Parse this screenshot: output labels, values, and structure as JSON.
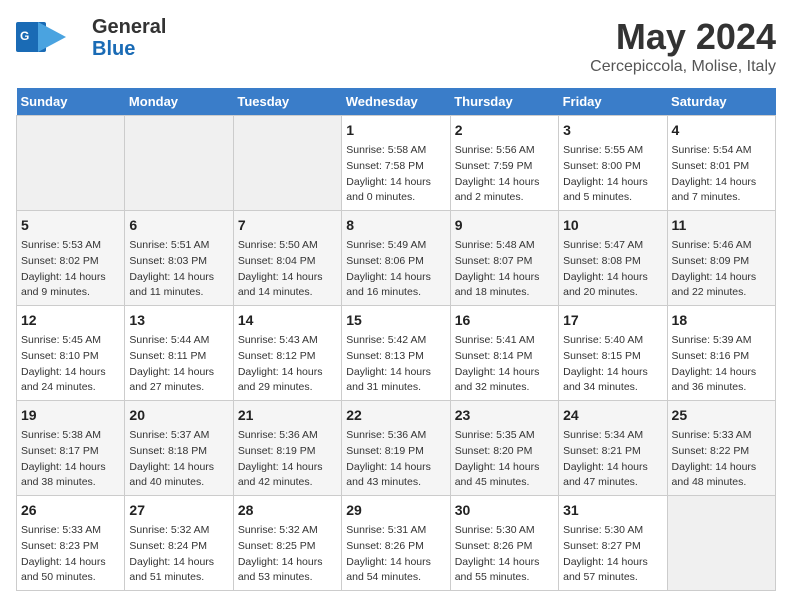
{
  "header": {
    "logo_line1": "General",
    "logo_line2": "Blue",
    "title": "May 2024",
    "subtitle": "Cercepiccola, Molise, Italy"
  },
  "days_of_week": [
    "Sunday",
    "Monday",
    "Tuesday",
    "Wednesday",
    "Thursday",
    "Friday",
    "Saturday"
  ],
  "weeks": [
    [
      {
        "day": "",
        "info": ""
      },
      {
        "day": "",
        "info": ""
      },
      {
        "day": "",
        "info": ""
      },
      {
        "day": "1",
        "info": "Sunrise: 5:58 AM\nSunset: 7:58 PM\nDaylight: 14 hours\nand 0 minutes."
      },
      {
        "day": "2",
        "info": "Sunrise: 5:56 AM\nSunset: 7:59 PM\nDaylight: 14 hours\nand 2 minutes."
      },
      {
        "day": "3",
        "info": "Sunrise: 5:55 AM\nSunset: 8:00 PM\nDaylight: 14 hours\nand 5 minutes."
      },
      {
        "day": "4",
        "info": "Sunrise: 5:54 AM\nSunset: 8:01 PM\nDaylight: 14 hours\nand 7 minutes."
      }
    ],
    [
      {
        "day": "5",
        "info": "Sunrise: 5:53 AM\nSunset: 8:02 PM\nDaylight: 14 hours\nand 9 minutes."
      },
      {
        "day": "6",
        "info": "Sunrise: 5:51 AM\nSunset: 8:03 PM\nDaylight: 14 hours\nand 11 minutes."
      },
      {
        "day": "7",
        "info": "Sunrise: 5:50 AM\nSunset: 8:04 PM\nDaylight: 14 hours\nand 14 minutes."
      },
      {
        "day": "8",
        "info": "Sunrise: 5:49 AM\nSunset: 8:06 PM\nDaylight: 14 hours\nand 16 minutes."
      },
      {
        "day": "9",
        "info": "Sunrise: 5:48 AM\nSunset: 8:07 PM\nDaylight: 14 hours\nand 18 minutes."
      },
      {
        "day": "10",
        "info": "Sunrise: 5:47 AM\nSunset: 8:08 PM\nDaylight: 14 hours\nand 20 minutes."
      },
      {
        "day": "11",
        "info": "Sunrise: 5:46 AM\nSunset: 8:09 PM\nDaylight: 14 hours\nand 22 minutes."
      }
    ],
    [
      {
        "day": "12",
        "info": "Sunrise: 5:45 AM\nSunset: 8:10 PM\nDaylight: 14 hours\nand 24 minutes."
      },
      {
        "day": "13",
        "info": "Sunrise: 5:44 AM\nSunset: 8:11 PM\nDaylight: 14 hours\nand 27 minutes."
      },
      {
        "day": "14",
        "info": "Sunrise: 5:43 AM\nSunset: 8:12 PM\nDaylight: 14 hours\nand 29 minutes."
      },
      {
        "day": "15",
        "info": "Sunrise: 5:42 AM\nSunset: 8:13 PM\nDaylight: 14 hours\nand 31 minutes."
      },
      {
        "day": "16",
        "info": "Sunrise: 5:41 AM\nSunset: 8:14 PM\nDaylight: 14 hours\nand 32 minutes."
      },
      {
        "day": "17",
        "info": "Sunrise: 5:40 AM\nSunset: 8:15 PM\nDaylight: 14 hours\nand 34 minutes."
      },
      {
        "day": "18",
        "info": "Sunrise: 5:39 AM\nSunset: 8:16 PM\nDaylight: 14 hours\nand 36 minutes."
      }
    ],
    [
      {
        "day": "19",
        "info": "Sunrise: 5:38 AM\nSunset: 8:17 PM\nDaylight: 14 hours\nand 38 minutes."
      },
      {
        "day": "20",
        "info": "Sunrise: 5:37 AM\nSunset: 8:18 PM\nDaylight: 14 hours\nand 40 minutes."
      },
      {
        "day": "21",
        "info": "Sunrise: 5:36 AM\nSunset: 8:19 PM\nDaylight: 14 hours\nand 42 minutes."
      },
      {
        "day": "22",
        "info": "Sunrise: 5:36 AM\nSunset: 8:19 PM\nDaylight: 14 hours\nand 43 minutes."
      },
      {
        "day": "23",
        "info": "Sunrise: 5:35 AM\nSunset: 8:20 PM\nDaylight: 14 hours\nand 45 minutes."
      },
      {
        "day": "24",
        "info": "Sunrise: 5:34 AM\nSunset: 8:21 PM\nDaylight: 14 hours\nand 47 minutes."
      },
      {
        "day": "25",
        "info": "Sunrise: 5:33 AM\nSunset: 8:22 PM\nDaylight: 14 hours\nand 48 minutes."
      }
    ],
    [
      {
        "day": "26",
        "info": "Sunrise: 5:33 AM\nSunset: 8:23 PM\nDaylight: 14 hours\nand 50 minutes."
      },
      {
        "day": "27",
        "info": "Sunrise: 5:32 AM\nSunset: 8:24 PM\nDaylight: 14 hours\nand 51 minutes."
      },
      {
        "day": "28",
        "info": "Sunrise: 5:32 AM\nSunset: 8:25 PM\nDaylight: 14 hours\nand 53 minutes."
      },
      {
        "day": "29",
        "info": "Sunrise: 5:31 AM\nSunset: 8:26 PM\nDaylight: 14 hours\nand 54 minutes."
      },
      {
        "day": "30",
        "info": "Sunrise: 5:30 AM\nSunset: 8:26 PM\nDaylight: 14 hours\nand 55 minutes."
      },
      {
        "day": "31",
        "info": "Sunrise: 5:30 AM\nSunset: 8:27 PM\nDaylight: 14 hours\nand 57 minutes."
      },
      {
        "day": "",
        "info": ""
      }
    ]
  ]
}
